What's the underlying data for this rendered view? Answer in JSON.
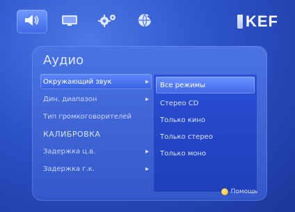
{
  "topbar": {
    "tabs": [
      {
        "icon": "speaker-icon",
        "active": true
      },
      {
        "icon": "display-icon",
        "active": false
      },
      {
        "icon": "gear-icon",
        "active": false
      },
      {
        "icon": "globe-icon",
        "active": false
      }
    ],
    "brand": "KEF"
  },
  "panel": {
    "title": "Аудио",
    "menu": [
      {
        "label": "Окружающий звук",
        "has_arrow": true,
        "selected": true
      },
      {
        "label": "Дин. диапазон",
        "has_arrow": true,
        "selected": false
      },
      {
        "label": "Тип громкоговорителей",
        "has_arrow": false,
        "selected": false
      },
      {
        "label": "КАЛИБРОВКА",
        "has_arrow": false,
        "selected": false
      },
      {
        "label": "Задержка ц.в.",
        "has_arrow": true,
        "selected": false
      },
      {
        "label": "Задержка г.к.",
        "has_arrow": true,
        "selected": false
      }
    ],
    "submenu": [
      {
        "label": "Все режимы",
        "selected": true
      },
      {
        "label": "Стерео CD",
        "selected": false
      },
      {
        "label": "Только кино",
        "selected": false
      },
      {
        "label": "Только стерео",
        "selected": false
      },
      {
        "label": "Только моно",
        "selected": false
      }
    ],
    "help_label": "Помощь"
  }
}
